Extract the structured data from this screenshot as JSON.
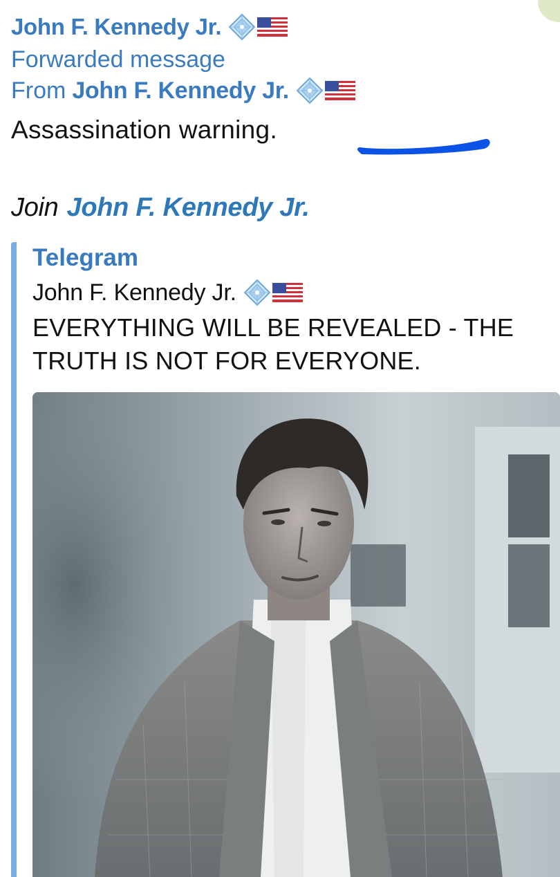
{
  "message": {
    "sender": "John F. Kennedy Jr.",
    "forwarded_label": "Forwarded message",
    "from_label": "From",
    "from_name": "John F. Kennedy Jr.",
    "text": "Assassination warning.",
    "join_label": "Join",
    "join_link": "John F. Kennedy Jr."
  },
  "preview": {
    "site_name": "Telegram",
    "title": "John F. Kennedy Jr.",
    "description": "EVERYTHING WILL BE REVEALED - THE TRUTH IS NOT FOR EVERYONE."
  },
  "icons": {
    "badge": "diamond-gem-icon",
    "flag": "us-flag-icon"
  },
  "colors": {
    "link": "#3a7bbf",
    "accent_bar": "#7aaee0",
    "scribble": "#0b52e6"
  }
}
